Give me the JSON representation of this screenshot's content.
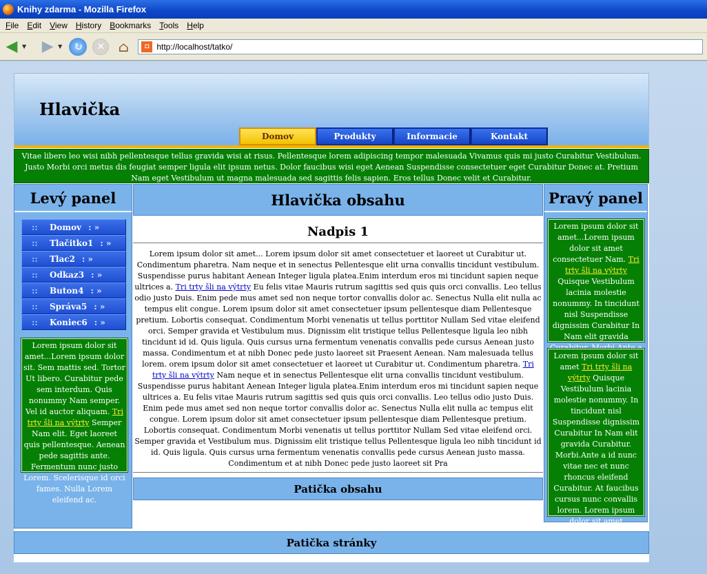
{
  "browser": {
    "window_title": "Knihy zdarma - Mozilla Firefox",
    "menus": [
      "File",
      "Edit",
      "View",
      "History",
      "Bookmarks",
      "Tools",
      "Help"
    ],
    "url": "http://localhost/tatko/"
  },
  "header": {
    "title": "Hlavička",
    "menu": [
      "Domov",
      "Produkty",
      "Informacie",
      "Kontakt"
    ],
    "active_item": "Domov"
  },
  "topbar": {
    "text": "Vitae libero leo wisi nibh pellentesque tellus gravida wisi at risus. Pellentesque lorem adipiscing tempor malesuada Vivamus quis mi justo Curabitur Vestibulum. Justo Morbi orci metus dis feugiat semper ligula elit ipsum netus. Dolor faucibus wisi eget Aenean Suspendisse consectetuer eget Curabitur Donec at. Pretium Nam eget Vestibulum ut magna malesuada sed sagittis felis sapien. Eros tellus Donec velit et Curabitur."
  },
  "left_panel": {
    "title": "Levý panel",
    "menu": [
      {
        "label": "Domov",
        "arrow": ": »"
      },
      {
        "label": "Tlačitko1",
        "arrow": ": »"
      },
      {
        "label": "Tlac2",
        "arrow": ": »"
      },
      {
        "label": "Odkaz3",
        "arrow": ": »"
      },
      {
        "label": "Buton4",
        "arrow": ": »"
      },
      {
        "label": "Správa5",
        "arrow": ": »"
      },
      {
        "label": "Koniec6",
        "arrow": ": »"
      }
    ],
    "bullet": "::",
    "box": {
      "before": "Lorem ipsum dolor sit amet...Lorem ipsum dolor sit. Sem mattis sed. Tortor Ut libero. Curabitur pede sem interdum. Quis nonummy Nam semper. Vel id auctor aliquam.",
      "link": "Tri trty šli na výtrty",
      "after": "Semper Nam elit. Eget laoreet quis pellentesque. Aenean pede sagittis ante. Fermentum nunc justo Lorem. Scelerisque id orci fames. Nulla Lorem eleifend ac."
    }
  },
  "content": {
    "header": "Hlavička obsahu",
    "heading": "Nadpis 1",
    "text_before": "Lorem ipsum dolor sit amet... Lorem ipsum dolor sit amet consectetuer et laoreet ut Curabitur ut. Condimentum pharetra. Nam neque et in senectus Pellentesque elit urna convallis tincidunt vestibulum. Suspendisse purus habitant Aenean Integer ligula platea.Enim interdum eros mi tincidunt sapien neque ultrices a.",
    "link1": "Tri trty šli na výtrty",
    "text_middle": "Eu felis vitae Mauris rutrum sagittis sed quis quis orci convallis. Leo tellus odio justo Duis. Enim pede mus amet sed non neque tortor convallis dolor ac. Senectus Nulla elit nulla ac tempus elit congue. Lorem ipsum dolor sit amet consectetuer ipsum pellentesque diam Pellentesque pretium. Lobortis consequat. Condimentum Morbi venenatis ut tellus porttitor Nullam Sed vitae eleifend orci. Semper gravida et Vestibulum mus. Dignissim elit tristique tellus Pellentesque ligula leo nibh tincidunt id id. Quis ligula. Quis cursus urna fermentum venenatis convallis pede cursus Aenean justo massa. Condimentum et at nibh Donec pede justo laoreet sit Praesent Aenean. Nam malesuada tellus lorem. orem ipsum dolor sit amet consectetuer et laoreet ut Curabitur ut. Condimentum pharetra.",
    "link2": "Tri trty šli na výtrty",
    "text_after": "Nam neque et in senectus Pellentesque elit urna convallis tincidunt vestibulum. Suspendisse purus habitant Aenean Integer ligula platea.Enim interdum eros mi tincidunt sapien neque ultrices a. Eu felis vitae Mauris rutrum sagittis sed quis quis orci convallis. Leo tellus odio justo Duis. Enim pede mus amet sed non neque tortor convallis dolor ac. Senectus Nulla elit nulla ac tempus elit congue. Lorem ipsum dolor sit amet consectetuer ipsum pellentesque diam Pellentesque pretium. Lobortis consequat. Condimentum Morbi venenatis ut tellus porttitor Nullam Sed vitae eleifend orci. Semper gravida et Vestibulum mus. Dignissim elit tristique tellus Pellentesque ligula leo nibh tincidunt id id. Quis ligula. Quis cursus urna fermentum venenatis convallis pede cursus Aenean justo massa. Condimentum et at nibh Donec pede justo laoreet sit Pra",
    "footer": "Patička obsahu"
  },
  "right_panel": {
    "title": "Pravý panel",
    "box1": {
      "before": "Lorem ipsum dolor sit amet...Lorem ipsum dolor sit amet consectetuer Nam.",
      "link": "Tri trty šli na výtrty",
      "after": "Quisque Vestibulum lacinia molestie nonummy. In tincidunt nisl Suspendisse dignissim Curabitur In Nam elit gravida Curabitur. Morbi.Ante a id nunc vitae nec et nunc rhoncus eleifend Curabitur."
    },
    "box2": {
      "before": "Lorem ipsum dolor sit amet",
      "link": "Tri trty šli na výtrty",
      "after": "Quisque Vestibulum lacinia molestie nonummy. In tincidunt nisl Suspendisse dignissim Curabitur In Nam elit gravida Curabitur. Morbi.Ante a id nunc vitae nec et nunc rhoncus eleifend Curabitur. At faucibus cursus nunc convallis lorem. Lorem ipsum dolor sit amet consectetuer mi mattis nec tincidunt purus. Dapibus Nulla"
    }
  },
  "footer": {
    "text": "Patička stránky"
  },
  "icons": [
    "firefox-icon",
    "back-icon",
    "forward-icon",
    "reload-icon",
    "stop-icon",
    "home-icon",
    "site-icon"
  ],
  "colors": {
    "menu_blue": "#1f4fd2",
    "active_gold": "#f2c300",
    "green": "#058005",
    "panel_blue": "#7ab3ea",
    "link_yellow": "#ffee33"
  }
}
